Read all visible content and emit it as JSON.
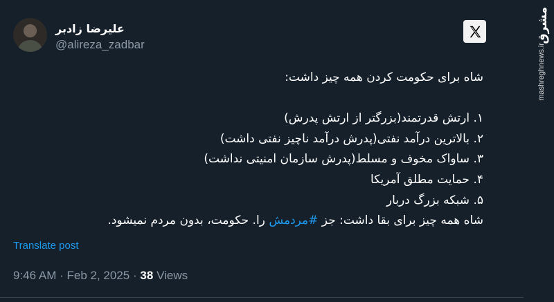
{
  "author": {
    "display_name": "علیرضا زادبر",
    "handle": "@alireza_zadbar"
  },
  "tweet": {
    "lines": [
      "شاه برای حکومت کردن همه چیز داشت:",
      "",
      "۱. ارتش قدرتمند(بزرگتر از ارتش پدرش)",
      "۲. بالاترین درآمد نفتی(پدرش درآمد ناچیز نفتی داشت)",
      "۳. ساواک مخوف و مسلط(پدرش سازمان امنیتی نداشت)",
      "۴. حمایت مطلق آمریکا",
      "۵. شبکه بزرگ دربار"
    ],
    "last_line_before": "شاه همه چیز برای بقا داشت: جز ",
    "hashtag": "#مردمش",
    "last_line_after": " را. حکومت، بدون مردم نمیشود."
  },
  "translate_label": "Translate post",
  "meta": {
    "time": "9:46 AM",
    "separator": "·",
    "date": "Feb 2, 2025",
    "views_count": "38",
    "views_label": "Views"
  },
  "watermark": {
    "logo": "مشرق",
    "url": "mashreghnews.ir"
  },
  "colors": {
    "background": "#15202b",
    "text": "#ffffff",
    "secondary": "#8b98a5",
    "link": "#1d9bf0"
  },
  "icons": {
    "avatar": "avatar",
    "x_logo": "x-logo-icon"
  }
}
